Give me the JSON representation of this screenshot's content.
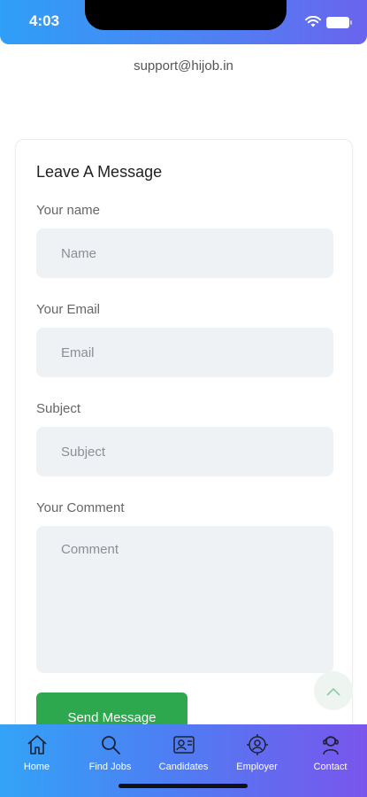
{
  "status_bar": {
    "time": "4:03"
  },
  "support_email": "support@hijob.in",
  "form": {
    "title": "Leave A Message",
    "name_label": "Your name",
    "name_placeholder": "Name",
    "email_label": "Your Email",
    "email_placeholder": "Email",
    "subject_label": "Subject",
    "subject_placeholder": "Subject",
    "comment_label": "Your Comment",
    "comment_placeholder": "Comment",
    "submit_label": "Send Message"
  },
  "bottom_nav": {
    "items": [
      {
        "label": "Home",
        "icon": "home-icon"
      },
      {
        "label": "Find Jobs",
        "icon": "search-icon"
      },
      {
        "label": "Candidates",
        "icon": "candidates-icon"
      },
      {
        "label": "Employer",
        "icon": "employer-icon"
      },
      {
        "label": "Contact",
        "icon": "contact-icon"
      }
    ]
  },
  "colors": {
    "gradient_start": "#2f9ff7",
    "gradient_end": "#7a55ec",
    "send_button": "#2ea84e",
    "field_background": "#eff2f5"
  }
}
